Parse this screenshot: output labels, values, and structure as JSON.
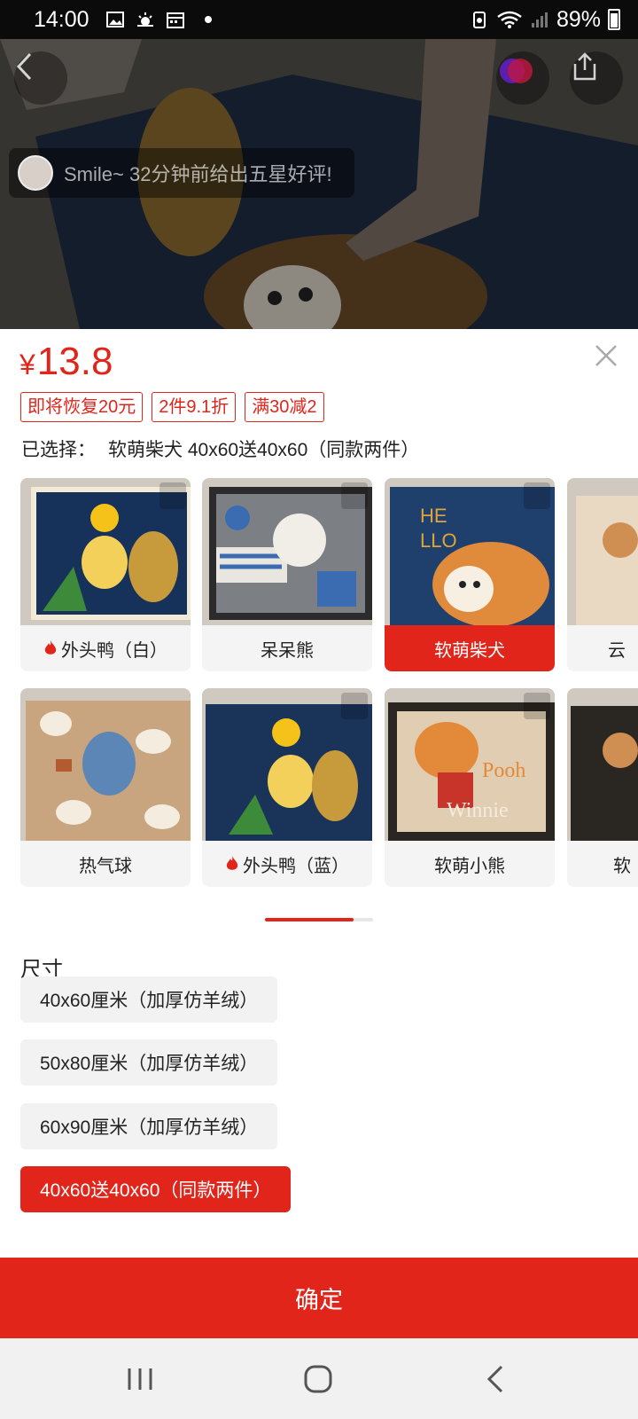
{
  "status_bar": {
    "time": "14:00",
    "battery": "89%"
  },
  "review_ticker": {
    "text": "Smile~ 32分钟前给出五星好评!"
  },
  "price": {
    "currency": "¥",
    "amount": "13.8"
  },
  "promo_tags": [
    "即将恢复20元",
    "2件9.1折",
    "满30减2"
  ],
  "selection": {
    "label": "已选择：",
    "value": "软萌柴犬 40x60送40x60（同款两件）"
  },
  "variants": [
    {
      "label": "外头鸭（白）",
      "hot": true,
      "selected": false
    },
    {
      "label": "呆呆熊",
      "hot": false,
      "selected": false
    },
    {
      "label": "软萌柴犬",
      "hot": false,
      "selected": true
    },
    {
      "label": "云",
      "hot": false,
      "selected": false
    },
    {
      "label": "热气球",
      "hot": false,
      "selected": false
    },
    {
      "label": "外头鸭（蓝）",
      "hot": true,
      "selected": false
    },
    {
      "label": "软萌小熊",
      "hot": false,
      "selected": false
    },
    {
      "label": "软",
      "hot": false,
      "selected": false
    }
  ],
  "size": {
    "title": "尺寸",
    "options": [
      {
        "label": "40x60厘米（加厚仿羊绒）",
        "selected": false
      },
      {
        "label": "50x80厘米（加厚仿羊绒）",
        "selected": false
      },
      {
        "label": "60x90厘米（加厚仿羊绒）",
        "selected": false
      },
      {
        "label": "40x60送40x60（同款两件）",
        "selected": true
      }
    ]
  },
  "confirm_label": "确定",
  "colors": {
    "accent": "#e1251b",
    "option_bg": "#f2f2f2"
  }
}
